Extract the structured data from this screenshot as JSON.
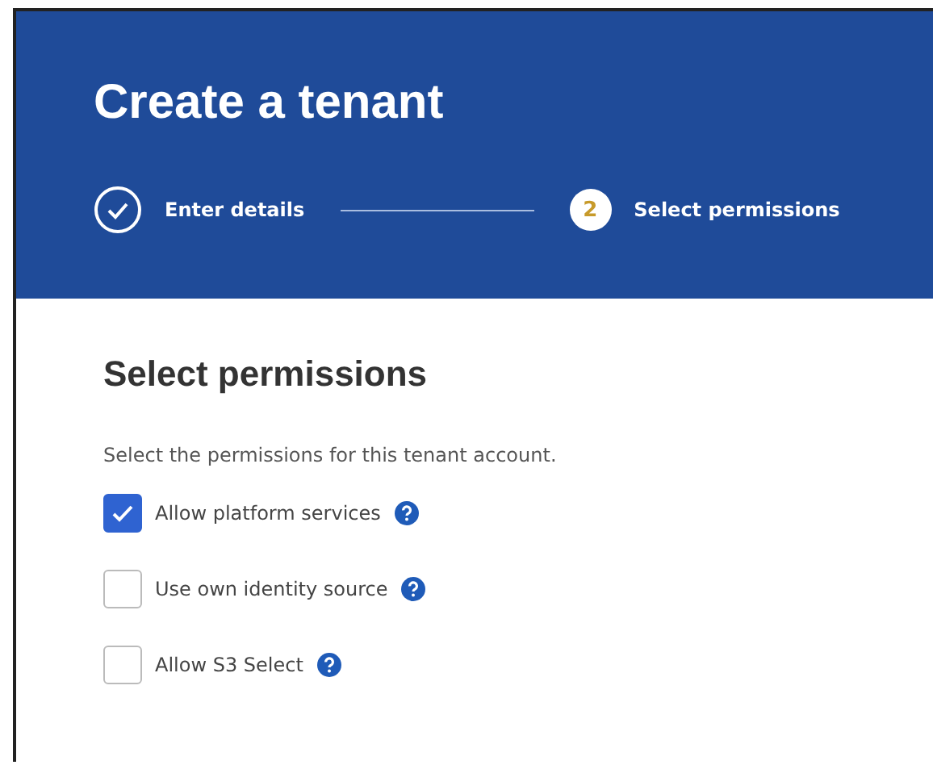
{
  "header": {
    "title": "Create a tenant"
  },
  "steps": [
    {
      "kind": "done",
      "label": "Enter details"
    },
    {
      "kind": "current",
      "number": "2",
      "label": "Select permissions"
    }
  ],
  "section": {
    "heading": "Select permissions",
    "description": "Select the permissions for this tenant account."
  },
  "permissions": [
    {
      "label": "Allow platform services",
      "checked": true
    },
    {
      "label": "Use own identity source",
      "checked": false
    },
    {
      "label": "Allow S3 Select",
      "checked": false
    }
  ]
}
